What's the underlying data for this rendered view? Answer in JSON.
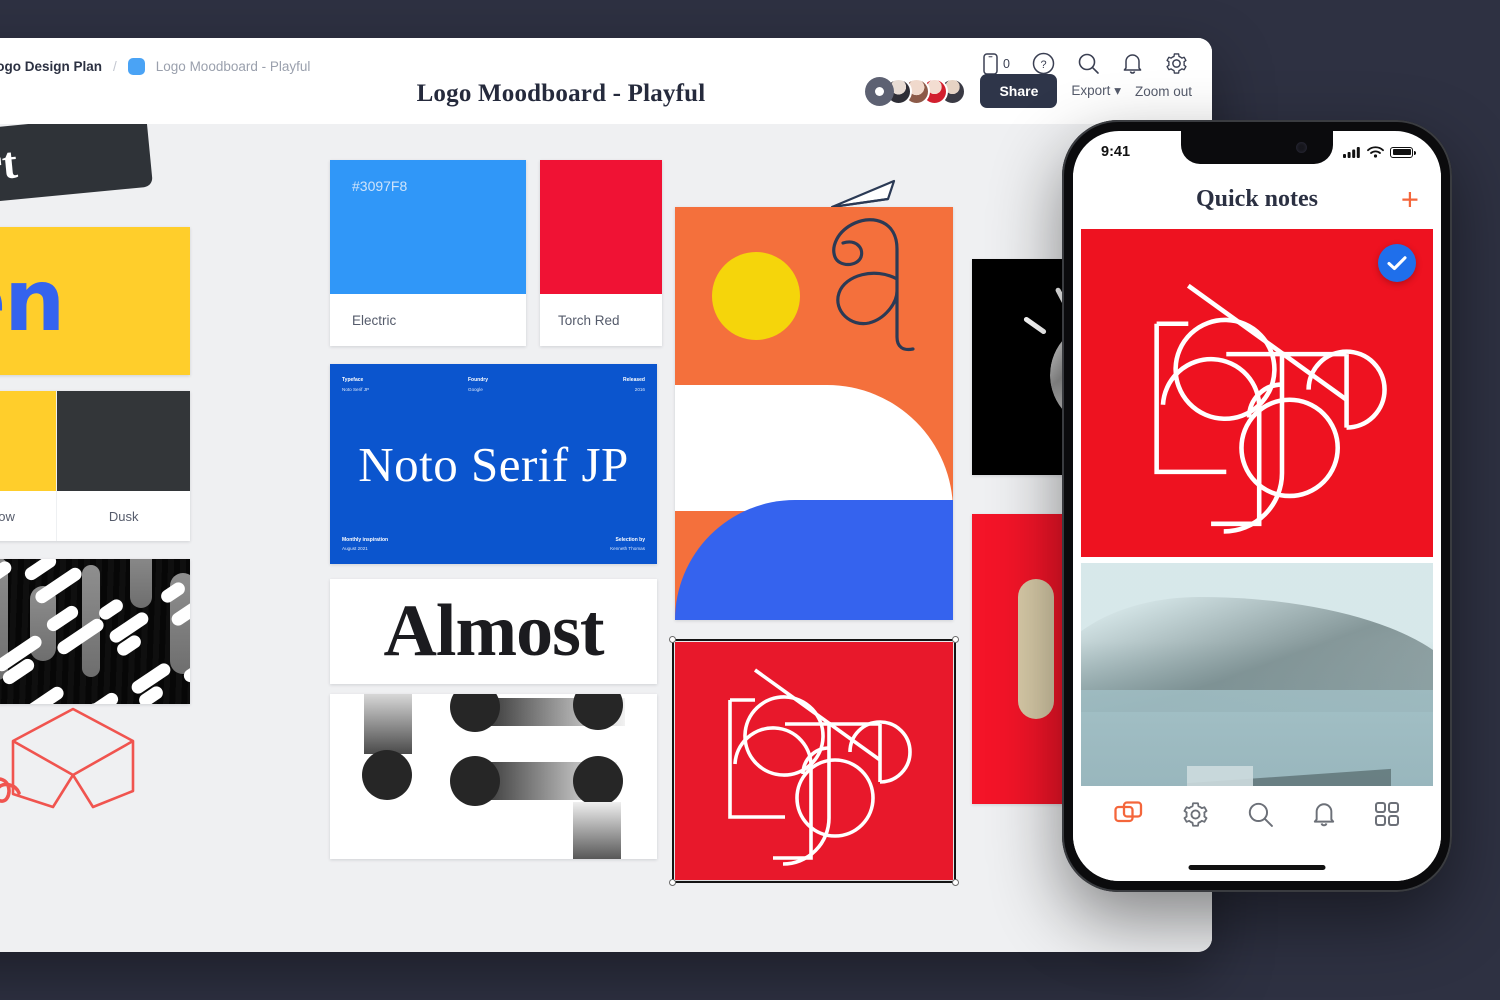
{
  "window": {
    "breadcrumb": {
      "parent": "Logo Design Plan",
      "separator": "/",
      "current": "Logo Moodboard - Playful",
      "swatch_color": "#4AA3F5"
    },
    "title": "Logo Moodboard - Playful",
    "top_icons": [
      {
        "name": "mobile-preview-icon",
        "count": "0"
      },
      {
        "name": "help-icon"
      },
      {
        "name": "search-icon"
      },
      {
        "name": "notifications-icon"
      },
      {
        "name": "settings-icon"
      }
    ],
    "actions": {
      "share_label": "Share",
      "export_label": "Export",
      "export_caret": "∨",
      "zoom_out_label": "Zoom out"
    },
    "collaborators": [
      "presence-eye",
      "avatar-1",
      "avatar-2",
      "avatar-3",
      "avatar-4"
    ]
  },
  "canvas": {
    "siren_card": {
      "word": "Siren",
      "bg": "#FFCE2B",
      "fg": "#3563EE"
    },
    "palette_left": [
      {
        "name": "",
        "color": "#3563EE"
      },
      {
        "name": "Sunglow",
        "color": "#FFCE2B"
      },
      {
        "name": "Dusk",
        "color": "#333639"
      }
    ],
    "swatch_electric": {
      "hex": "#3097F8",
      "name": "Electric",
      "color": "#3097F8"
    },
    "swatch_torch": {
      "hex": "",
      "name": "Torch Red",
      "color": "#F01234"
    },
    "type_card": {
      "headline": "Noto Serif JP",
      "bg": "#0B55CE",
      "meta": [
        {
          "label": "Typeface",
          "value": "Noto Serif JP"
        },
        {
          "label": "Foundry",
          "value": "Google"
        },
        {
          "label": "Released",
          "value": "2016"
        },
        {
          "label": "Monthly inspiration",
          "value": "August 2021"
        },
        {
          "label": "Selection by",
          "value": "Kenneth Thomas"
        }
      ]
    },
    "almost_card": {
      "word": "Almost"
    },
    "fortune_card": {
      "word": "Fort"
    },
    "poster_card": {
      "glyph": "a",
      "bg": "#F4703C",
      "sun": "#F5D50B",
      "arc": "#3563EE"
    },
    "logo_card": {
      "bg": "#E8182B",
      "selected": true
    },
    "ring_card": {
      "bg": "#000000"
    },
    "io_card": {
      "bg": "#F41428",
      "shape_color": "#D8CBA8"
    },
    "noise_card": {
      "bg": "#070707",
      "annotation_color": "#F0544F",
      "annotation_text": "ne"
    },
    "dots_card": {
      "bg": "#FFFFFF",
      "dot_color": "#262626"
    }
  },
  "phone": {
    "status": {
      "time": "9:41",
      "cellular": "signal-bars",
      "wifi": "wifi",
      "battery": "battery-full"
    },
    "header": {
      "title": "Quick notes",
      "add_label": "+"
    },
    "notes": [
      {
        "type": "logo-sketch",
        "bg": "#EE1220",
        "selected": true,
        "check_color": "#1F6FEB"
      },
      {
        "type": "photo",
        "caption": ""
      }
    ],
    "tabs": [
      {
        "name": "cards-tab",
        "active": true
      },
      {
        "name": "settings-tab",
        "active": false
      },
      {
        "name": "search-tab",
        "active": false
      },
      {
        "name": "notifications-tab",
        "active": false
      },
      {
        "name": "grid-tab",
        "active": false
      }
    ],
    "accent": "#F4663B"
  }
}
